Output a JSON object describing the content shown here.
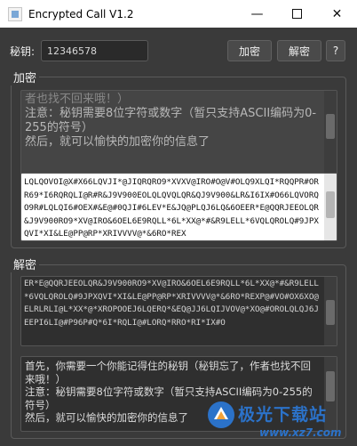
{
  "window": {
    "title": "Encrypted Call V1.2",
    "minimize_glyph": "—",
    "close_glyph": "✕"
  },
  "toolbar": {
    "key_label": "秘钥:",
    "key_value": "12346578",
    "encrypt_button": "加密",
    "decrypt_button": "解密",
    "help_button": "?"
  },
  "encrypt_group": {
    "title": "加密",
    "plaintext_faded": "者也找不回来哦！）",
    "plaintext": "注意：秘钥需要8位字符或数字（暂只支持ASCII编码为0-255的符号）\n然后，就可以愉快的加密你的信息了",
    "ciphertext": "LQLQOVOI@X#X66LQVJI*@JIQRQRO9*XVXV@IRO#O@V#OLQ9XLQI*RQQPR#ORR69*I6RQRQLI@R#R&J9V900EOLQLQVQLQR&QJ9V900&LR&I6IX#O66LQVORQO9R#LQLQI6#OEX#&E@#0QJI#6LEV*E&JQ@PLQJ6LQ&6OEER*E@QQRJEEOLQR&J9V900RO9*XV@IRO&6OEL6E9RQLL*6L*XX@*#&R9LELL*6VQLQROLQ#9JPXQVI*XI&LE@PP@RP*XRIVVVV@*&6RO*REX"
  },
  "decrypt_group": {
    "title": "解密",
    "ciphertext": "ER*E@QQRJEEOLQR&J9V900RO9*XV@IRO&6OEL6E9RQLL*6L*XX@*#&R9LELL*6VQLQROLQ#9JPXQVI*XI&LE@PP@RP*XRIVVVV@*&6RO*REXP@#VO#OX6XO@ELRLRLI@L*XX*@*XROPOOEJ6LQERQ*&EQ@JJ6LQIJVOV@*XO@#OROLQLQJ6JEEPI6LI@#P96P#Q*6I*RQLI@#LORQ*RRO*RI*IX#O",
    "plaintext": "首先，你需要一个你能记得住的秘钥（秘钥忘了，作者也找不回来哦！）\n注意：秘钥需要8位字符或数字（暂只支持ASCII编码为0-255的符号）\n然后，就可以愉快的加密你的信息了"
  },
  "watermark": {
    "name": "极光下载站",
    "url": "www.xz7.com"
  },
  "colors": {
    "window_bg": "#3a3a3a",
    "titlebar_bg": "#ffffff",
    "watermark_blue": "#2b72c9"
  }
}
